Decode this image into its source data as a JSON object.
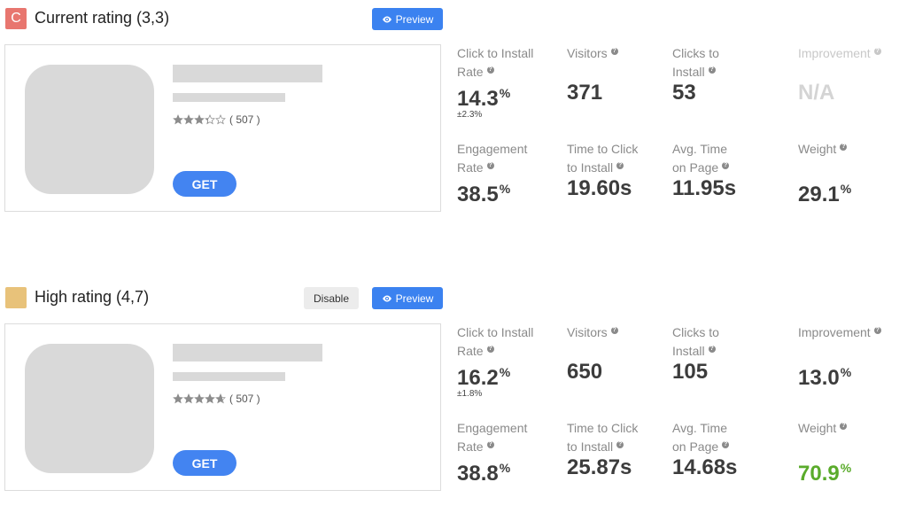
{
  "variants": [
    {
      "badge_letter": "C",
      "badge_color": "#e8766f",
      "title": "Current rating (3,3)",
      "preview_label": "Preview",
      "disable_label": null,
      "card": {
        "rating_stars": 3.3,
        "review_count": "( 507 )",
        "get_label": "GET"
      },
      "metrics": {
        "click_to_install_rate": {
          "label": "Click to Install\nRate",
          "value": "14.3",
          "unit": "%",
          "sub": "±2.3%"
        },
        "visitors": {
          "label": "Visitors",
          "value": "371"
        },
        "clicks_to_install": {
          "label": "Clicks to\nInstall",
          "value": "53"
        },
        "improvement": {
          "label": "Improvement",
          "value": "N/A",
          "unit": "",
          "disabled": true
        },
        "engagement_rate": {
          "label": "Engagement\nRate",
          "value": "38.5",
          "unit": "%"
        },
        "time_to_click": {
          "label": "Time to Click\nto Install",
          "value": "19.60s"
        },
        "avg_time_on_page": {
          "label": "Avg. Time\non Page",
          "value": "11.95s"
        },
        "weight": {
          "label": "Weight",
          "value": "29.1",
          "unit": "%"
        }
      }
    },
    {
      "badge_letter": "",
      "badge_color": "#e8c27a",
      "title": "High rating (4,7)",
      "preview_label": "Preview",
      "disable_label": "Disable",
      "card": {
        "rating_stars": 4.7,
        "review_count": "( 507 )",
        "get_label": "GET"
      },
      "metrics": {
        "click_to_install_rate": {
          "label": "Click to Install\nRate",
          "value": "16.2",
          "unit": "%",
          "sub": "±1.8%"
        },
        "visitors": {
          "label": "Visitors",
          "value": "650"
        },
        "clicks_to_install": {
          "label": "Clicks to\nInstall",
          "value": "105"
        },
        "improvement": {
          "label": "Improvement",
          "value": "13.0",
          "unit": "%"
        },
        "engagement_rate": {
          "label": "Engagement\nRate",
          "value": "38.8",
          "unit": "%"
        },
        "time_to_click": {
          "label": "Time to Click\nto Install",
          "value": "25.87s"
        },
        "avg_time_on_page": {
          "label": "Avg. Time\non Page",
          "value": "14.68s"
        },
        "weight": {
          "label": "Weight",
          "value": "70.9",
          "unit": "%",
          "color": "#5aab2b"
        }
      }
    }
  ],
  "icons": {
    "help": "question-circle-icon",
    "preview": "eye-icon",
    "star": "star-icon"
  }
}
